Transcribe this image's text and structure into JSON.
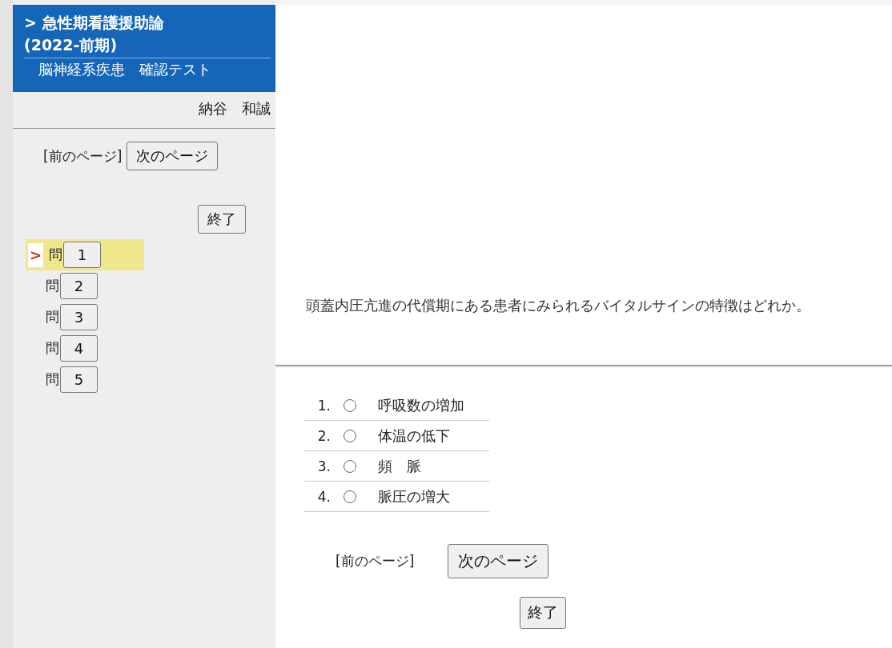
{
  "sidebar": {
    "title_lines": [
      "> 急性期看護援助論",
      "(2022-前期)"
    ],
    "subtitle": "脳神経系疾患　確認テスト",
    "user": "納谷　和誠",
    "prev_label": "[前のページ]",
    "next_button": "次のページ",
    "end_button": "終了",
    "current_marker": ">",
    "questions": [
      {
        "prefix": "問",
        "number": "1",
        "selected": true
      },
      {
        "prefix": "問",
        "number": "2",
        "selected": false
      },
      {
        "prefix": "問",
        "number": "3",
        "selected": false
      },
      {
        "prefix": "問",
        "number": "4",
        "selected": false
      },
      {
        "prefix": "問",
        "number": "5",
        "selected": false
      }
    ]
  },
  "main": {
    "question": "頭蓋内圧亢進の代償期にある患者にみられるバイタルサインの特徴はどれか。",
    "choices": [
      {
        "number": "1.",
        "text": "呼吸数の増加",
        "selected": false
      },
      {
        "number": "2.",
        "text": "体温の低下",
        "selected": false
      },
      {
        "number": "3.",
        "text": "頻　脈",
        "selected": false
      },
      {
        "number": "4.",
        "text": "脈圧の増大",
        "selected": false
      }
    ],
    "prev_label": "[前のページ]",
    "next_button": "次のページ",
    "end_button": "終了"
  }
}
